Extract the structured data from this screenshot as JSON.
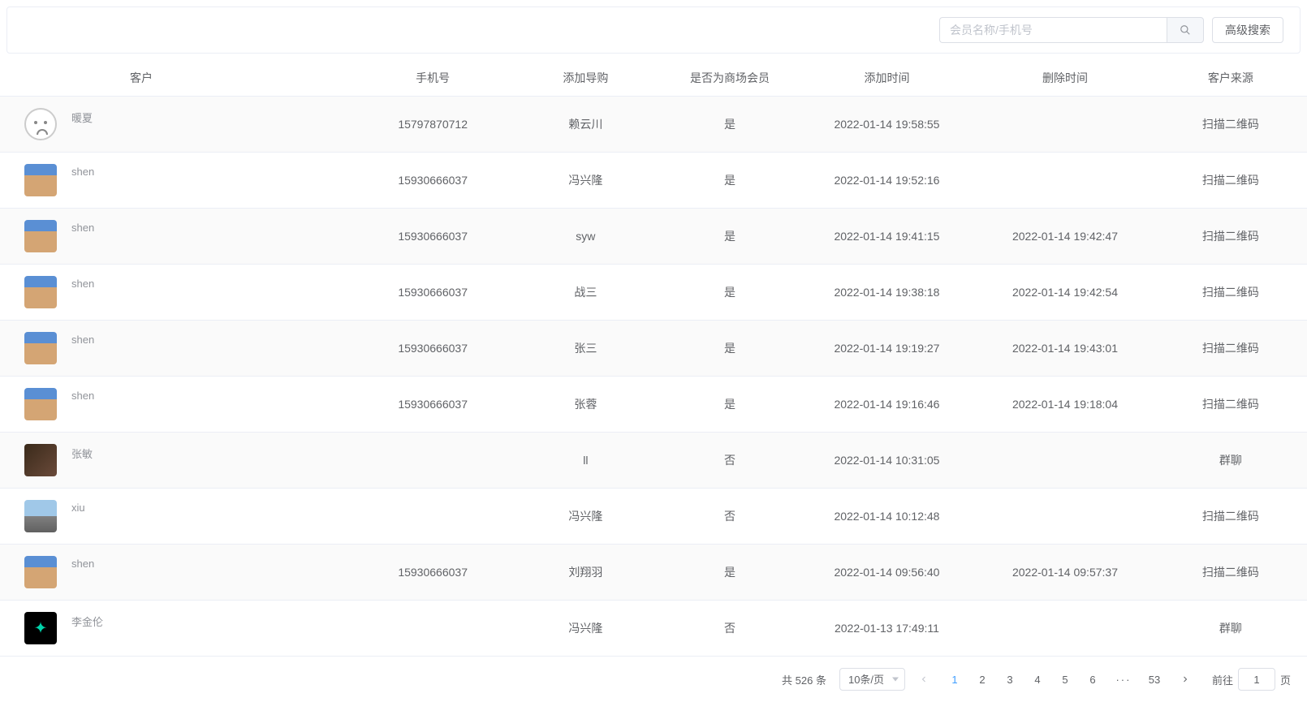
{
  "toolbar": {
    "search_placeholder": "会员名称/手机号",
    "advanced_label": "高级搜索"
  },
  "table": {
    "headers": {
      "customer": "客户",
      "phone": "手机号",
      "guide": "添加导购",
      "is_member": "是否为商场会员",
      "add_time": "添加时间",
      "del_time": "删除时间",
      "source": "客户来源"
    },
    "rows": [
      {
        "name": "暖夏",
        "avatar": "face",
        "phone": "15797870712",
        "guide": "赖云川",
        "is_member": "是",
        "add_time": "2022-01-14 19:58:55",
        "del_time": "",
        "source": "扫描二维码"
      },
      {
        "name": "shen",
        "avatar": "dog",
        "phone": "15930666037",
        "guide": "冯兴隆",
        "is_member": "是",
        "add_time": "2022-01-14 19:52:16",
        "del_time": "",
        "source": "扫描二维码"
      },
      {
        "name": "shen",
        "avatar": "dog",
        "phone": "15930666037",
        "guide": "syw",
        "is_member": "是",
        "add_time": "2022-01-14 19:41:15",
        "del_time": "2022-01-14 19:42:47",
        "source": "扫描二维码"
      },
      {
        "name": "shen",
        "avatar": "dog",
        "phone": "15930666037",
        "guide": "战三",
        "is_member": "是",
        "add_time": "2022-01-14 19:38:18",
        "del_time": "2022-01-14 19:42:54",
        "source": "扫描二维码"
      },
      {
        "name": "shen",
        "avatar": "dog",
        "phone": "15930666037",
        "guide": "张三",
        "is_member": "是",
        "add_time": "2022-01-14 19:19:27",
        "del_time": "2022-01-14 19:43:01",
        "source": "扫描二维码"
      },
      {
        "name": "shen",
        "avatar": "dog",
        "phone": "15930666037",
        "guide": "张蓉",
        "is_member": "是",
        "add_time": "2022-01-14 19:16:46",
        "del_time": "2022-01-14 19:18:04",
        "source": "扫描二维码"
      },
      {
        "name": "张敏",
        "avatar": "person",
        "phone": "",
        "guide": "ll",
        "is_member": "否",
        "add_time": "2022-01-14 10:31:05",
        "del_time": "",
        "source": "群聊"
      },
      {
        "name": "xiu",
        "avatar": "road",
        "phone": "",
        "guide": "冯兴隆",
        "is_member": "否",
        "add_time": "2022-01-14 10:12:48",
        "del_time": "",
        "source": "扫描二维码"
      },
      {
        "name": "shen",
        "avatar": "dog",
        "phone": "15930666037",
        "guide": "刘翔羽",
        "is_member": "是",
        "add_time": "2022-01-14 09:56:40",
        "del_time": "2022-01-14 09:57:37",
        "source": "扫描二维码"
      },
      {
        "name": "李金伦",
        "avatar": "diamond",
        "phone": "",
        "guide": "冯兴隆",
        "is_member": "否",
        "add_time": "2022-01-13 17:49:11",
        "del_time": "",
        "source": "群聊"
      }
    ]
  },
  "pagination": {
    "total_prefix": "共",
    "total_count": "526",
    "total_suffix": "条",
    "page_size_label": "10条/页",
    "pages": [
      "1",
      "2",
      "3",
      "4",
      "5",
      "6"
    ],
    "ellipsis": "···",
    "last_page": "53",
    "current_page": "1",
    "jump_prefix": "前往",
    "jump_value": "1",
    "jump_suffix": "页"
  }
}
